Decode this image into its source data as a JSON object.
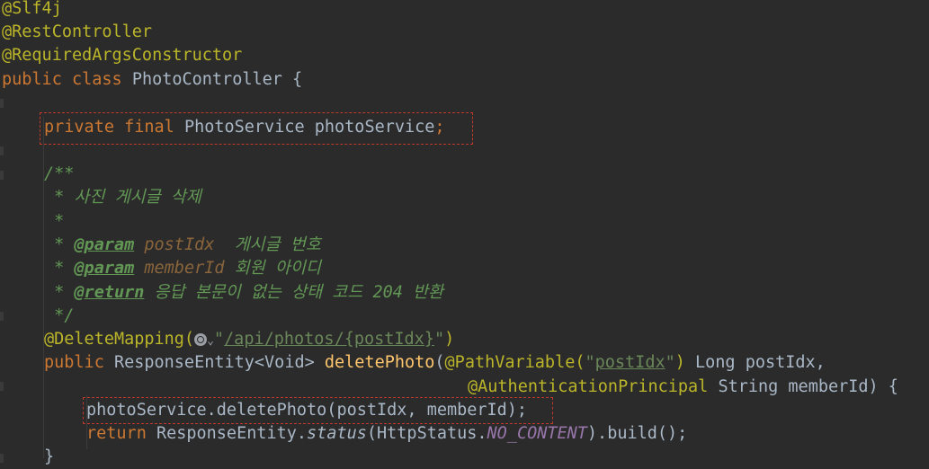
{
  "lines": {
    "l1": "@Slf4j",
    "l2": "@RestController",
    "l3": "@RequiredArgsConstructor",
    "l4_kw1": "public",
    "l4_kw2": "class",
    "l4_name": "PhotoController",
    "l4_brace": "{",
    "l6_kw1": "private",
    "l6_kw2": "final",
    "l6_type": "PhotoService",
    "l6_name": "photoService",
    "l6_semi": ";",
    "l8": "/**",
    "l9": " * 사진 게시글 삭제",
    "l10": " *",
    "l11_star": " * ",
    "l11_tag": "@param",
    "l11_p": "postIdx",
    "l11_desc": "  게시글 번호",
    "l12_star": " * ",
    "l12_tag": "@param",
    "l12_p": "memberId",
    "l12_desc": " 회원 아이디",
    "l13_star": " * ",
    "l13_tag": "@return",
    "l13_desc": " 응답 본문이 없는 상태 코드 204 반환",
    "l14": " */",
    "l15_ann": "@DeleteMapping(",
    "l15_url": "/api/photos/{postIdx}",
    "l15_q1": "\"",
    "l15_q2": "\"",
    "l15_close": ")",
    "l16_kw": "public",
    "l16_type": "ResponseEntity<Void>",
    "l16_fn": "deletePhoto",
    "l16_open": "(",
    "l16_ann": "@PathVariable(",
    "l16_q1": "\"",
    "l16_str": "postIdx",
    "l16_q2": "\"",
    "l16_close": ")",
    "l16_rest": " Long postIdx,",
    "l17_ann": "@AuthenticationPrincipal",
    "l17_rest": " String memberId) {",
    "l18": "photoService.deletePhoto(postIdx, memberId);",
    "l19_kw": "return",
    "l19_a": " ResponseEntity.",
    "l19_status": "status",
    "l19_b": "(HttpStatus.",
    "l19_const": "NO_CONTENT",
    "l19_c": ").build();",
    "l20": "}"
  },
  "colors": {
    "background": "#2b2b2b",
    "annotation": "#bbb529",
    "keyword": "#cc7832",
    "method": "#ffc66d",
    "string": "#6a8759",
    "doc_comment": "#629755",
    "highlight_border": "#c0392b"
  },
  "icons": {
    "mapping_icon": "globe-icon"
  }
}
